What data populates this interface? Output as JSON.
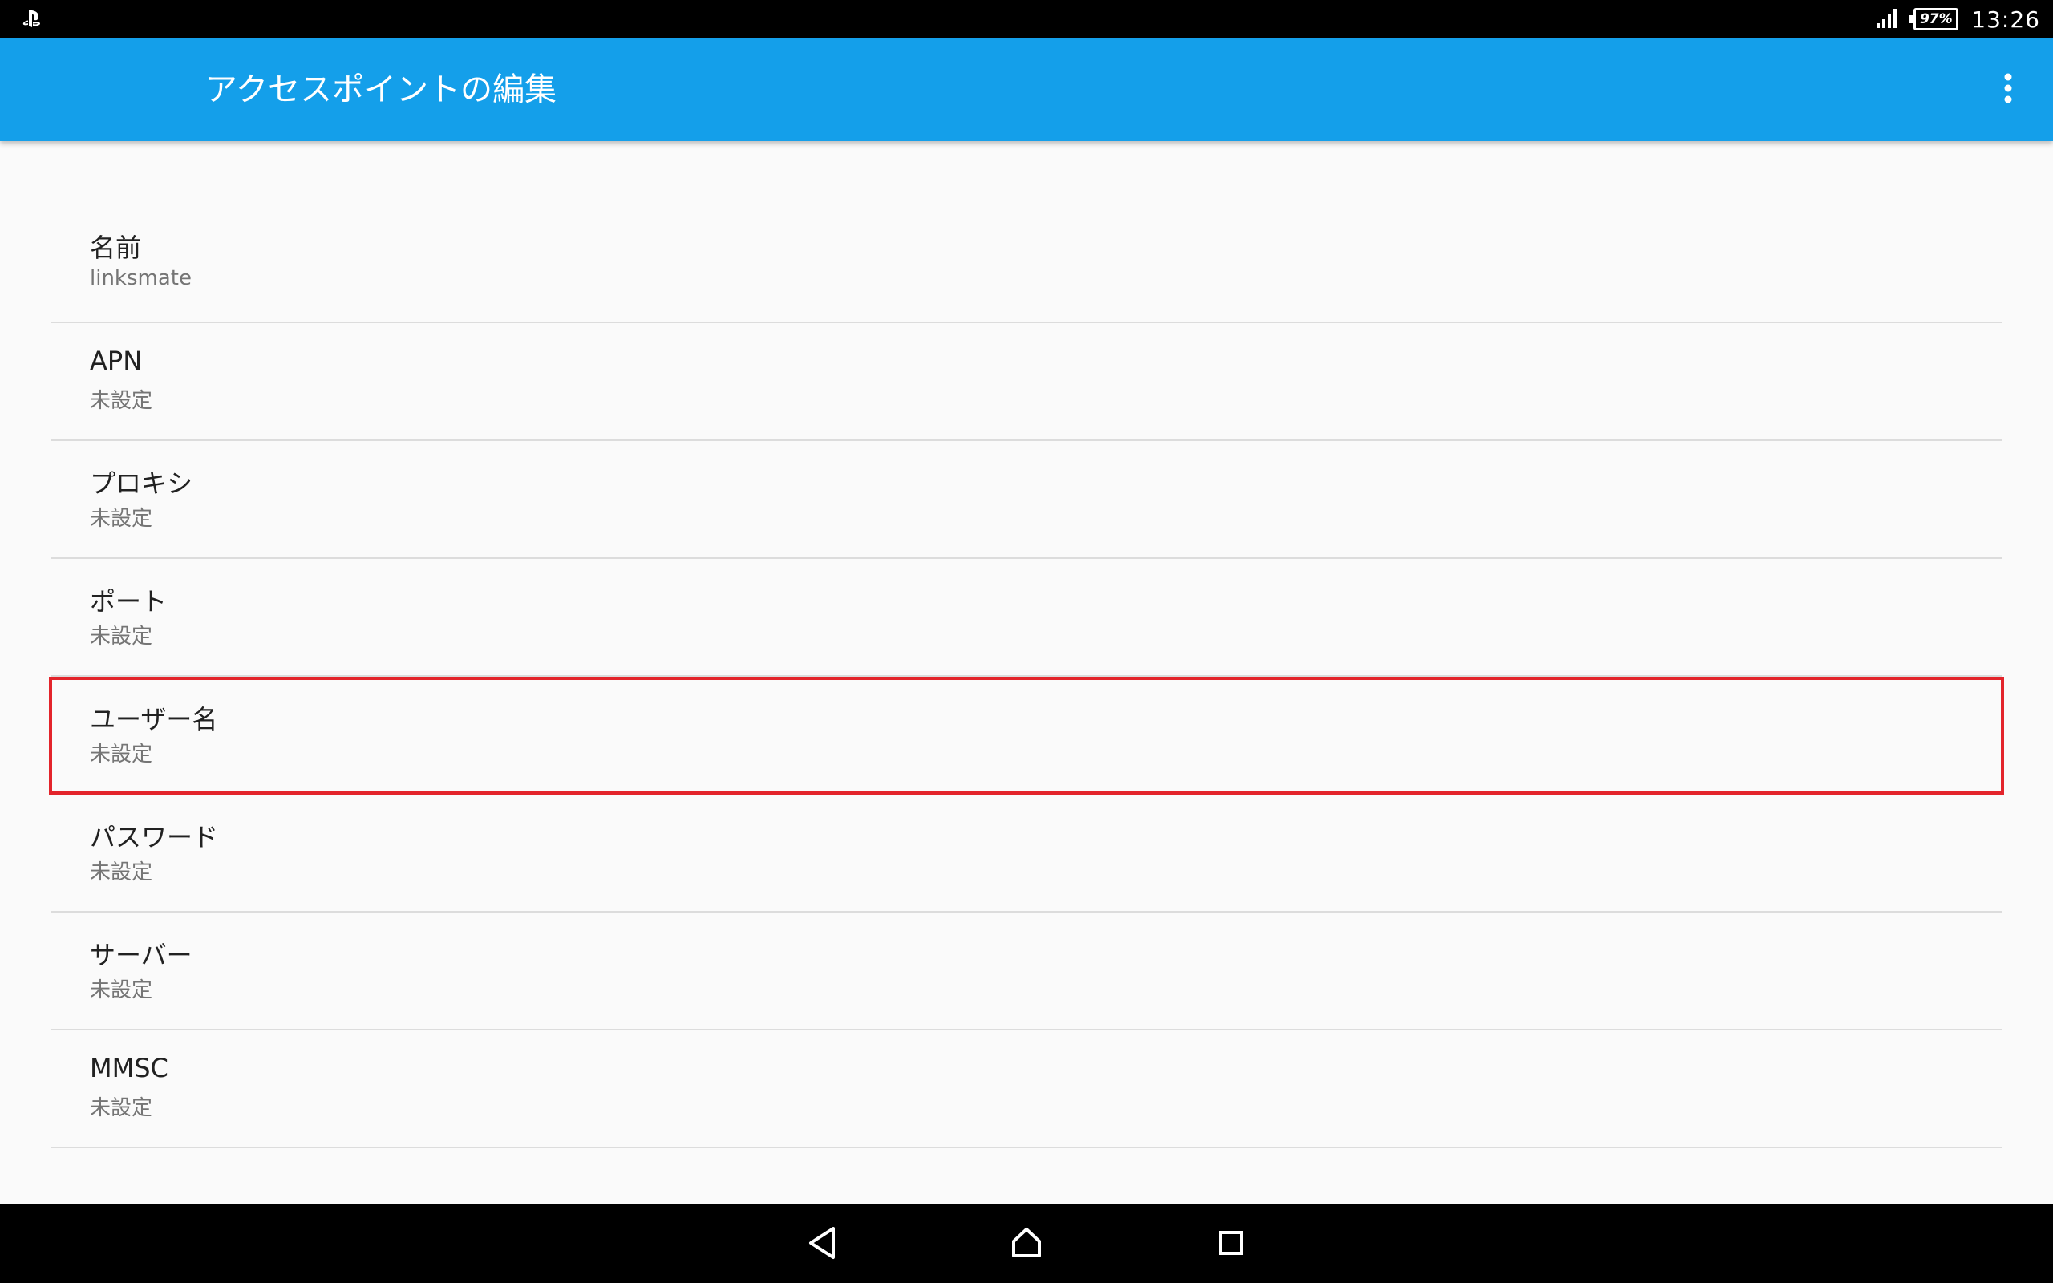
{
  "status_bar": {
    "left_icon": "playstation-app-icon",
    "signal_icon": "cell-signal-icon",
    "battery_level": "97%",
    "time": "13:26"
  },
  "app_bar": {
    "title": "アクセスポイントの編集",
    "menu_icon": "overflow-menu-icon"
  },
  "preferences": {
    "items": [
      {
        "title": "名前",
        "summary": "linksmate"
      },
      {
        "title": "APN",
        "summary": "未設定"
      },
      {
        "title": "プロキシ",
        "summary": "未設定"
      },
      {
        "title": "ポート",
        "summary": "未設定"
      },
      {
        "title": "ユーザー名",
        "summary": "未設定"
      },
      {
        "title": "パスワード",
        "summary": "未設定"
      },
      {
        "title": "サーバー",
        "summary": "未設定"
      },
      {
        "title": "MMSC",
        "summary": "未設定"
      }
    ]
  },
  "highlight": {
    "color": "#e3242b"
  },
  "nav_bar": {
    "back_icon": "back-triangle-icon",
    "home_icon": "home-icon",
    "recents_icon": "recents-square-icon"
  },
  "colors": {
    "app_bar": "#149fea",
    "background": "#fafafa",
    "divider": "#dcdcdc"
  }
}
